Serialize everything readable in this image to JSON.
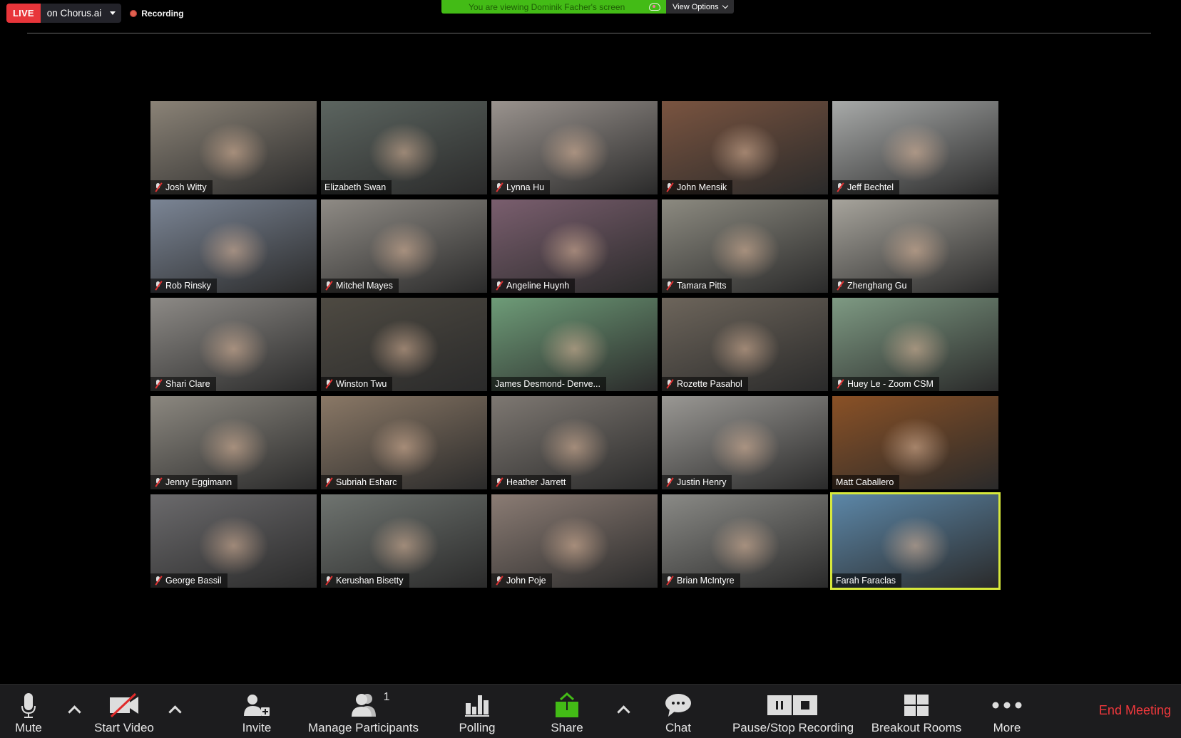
{
  "live": {
    "tag": "LIVE",
    "platform": "on Chorus.ai",
    "recording_label": "Recording"
  },
  "share_banner": {
    "viewing_text": "You are viewing Dominik Facher's screen",
    "view_options_label": "View Options"
  },
  "colors": {
    "live_red": "#e8353a",
    "banner_green": "#43bb16",
    "share_green": "#43bb16",
    "active_speaker_border": "#d7e83b",
    "end_meeting_red": "#f0383c"
  },
  "participants": [
    {
      "name": "Josh Witty",
      "muted": true,
      "bg": "#8b8377"
    },
    {
      "name": "Elizabeth Swan",
      "muted": false,
      "bg": "#5c6560"
    },
    {
      "name": "Lynna Hu",
      "muted": true,
      "bg": "#9a938e"
    },
    {
      "name": "John Mensik",
      "muted": true,
      "bg": "#7a5440"
    },
    {
      "name": "Jeff Bechtel",
      "muted": true,
      "bg": "#a8aaa9"
    },
    {
      "name": "Rob Rinsky",
      "muted": true,
      "bg": "#7b8595"
    },
    {
      "name": "Mitchel Mayes",
      "muted": true,
      "bg": "#8f8b85"
    },
    {
      "name": "Angeline Huynh",
      "muted": true,
      "bg": "#7a5e6e"
    },
    {
      "name": "Tamara Pitts",
      "muted": true,
      "bg": "#8c8a80"
    },
    {
      "name": "Zhenghang Gu",
      "muted": true,
      "bg": "#a7a49c"
    },
    {
      "name": "Shari Clare",
      "muted": true,
      "bg": "#8d8a86"
    },
    {
      "name": "Winston Twu",
      "muted": true,
      "bg": "#4e4a42"
    },
    {
      "name": "James Desmond- Denve...",
      "muted": false,
      "bg": "#6e9c78"
    },
    {
      "name": "Rozette Pasahol",
      "muted": true,
      "bg": "#6d655b"
    },
    {
      "name": "Huey Le - Zoom CSM",
      "muted": true,
      "bg": "#7e9a83"
    },
    {
      "name": "Jenny Eggimann",
      "muted": true,
      "bg": "#8c8880"
    },
    {
      "name": "Subriah Esharc",
      "muted": true,
      "bg": "#8a7866"
    },
    {
      "name": "Heather Jarrett",
      "muted": true,
      "bg": "#7e7872"
    },
    {
      "name": "Justin Henry",
      "muted": true,
      "bg": "#9a9894"
    },
    {
      "name": "Matt Caballero",
      "muted": false,
      "bg": "#8a5126"
    },
    {
      "name": "George Bassil",
      "muted": true,
      "bg": "#6b6a6c"
    },
    {
      "name": "Kerushan Bisetty",
      "muted": true,
      "bg": "#6f7470"
    },
    {
      "name": "John Poje",
      "muted": true,
      "bg": "#8b7c74"
    },
    {
      "name": "Brian McIntyre",
      "muted": true,
      "bg": "#8a8a86"
    },
    {
      "name": "Farah Faraclas",
      "muted": false,
      "bg": "#5c87a8",
      "active_speaker": true
    }
  ],
  "toolbar": {
    "mute": "Mute",
    "start_video": "Start Video",
    "invite": "Invite",
    "manage_participants": "Manage Participants",
    "participant_count": "1",
    "polling": "Polling",
    "share": "Share",
    "chat": "Chat",
    "pause_stop_recording": "Pause/Stop Recording",
    "breakout_rooms": "Breakout Rooms",
    "more": "More",
    "end_meeting": "End Meeting"
  }
}
